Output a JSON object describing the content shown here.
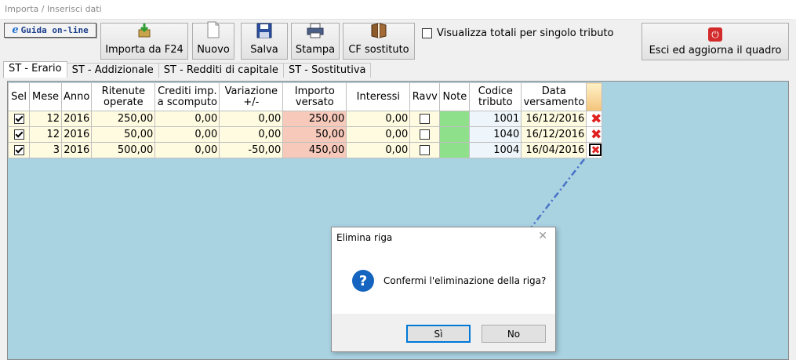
{
  "window": {
    "title": "Importa / Inserisci dati"
  },
  "toolbar": {
    "guida_label": "Guida on-line",
    "guida_icon": "ie-icon",
    "buttons": [
      {
        "label": "Importa da F24",
        "icon": "import-icon"
      },
      {
        "label": "Nuovo",
        "icon": "new-document-icon"
      },
      {
        "label": "Salva",
        "icon": "save-icon"
      },
      {
        "label": "Stampa",
        "icon": "printer-icon"
      },
      {
        "label": "CF sostituto",
        "icon": "book-icon"
      }
    ],
    "checkbox_totali_label": "Visualizza totali per singolo tributo",
    "checkbox_totali_checked": false,
    "exit_label": "Esci ed aggiorna il quadro",
    "exit_icon": "power-icon"
  },
  "tabs": [
    {
      "label": "ST - Erario",
      "active": true
    },
    {
      "label": "ST - Addizionale",
      "active": false
    },
    {
      "label": "ST - Redditi di capitale",
      "active": false
    },
    {
      "label": "ST - Sostitutiva",
      "active": false
    }
  ],
  "table": {
    "columns": {
      "sel": "Sel",
      "mese": "Mese",
      "anno": "Anno",
      "ritenute_1": "Ritenute",
      "ritenute_2": "operate",
      "crediti_1": "Crediti imp.",
      "crediti_2": "a scomputo",
      "variazione_1": "Variazione",
      "variazione_2": "+/-",
      "importo_1": "Importo",
      "importo_2": "versato",
      "interessi": "Interessi",
      "ravv": "Ravv",
      "note": "Note",
      "codice_1": "Codice",
      "codice_2": "tributo",
      "data_1": "Data",
      "data_2": "versamento"
    },
    "rows": [
      {
        "sel": true,
        "mese": "12",
        "anno": "2016",
        "ritenute": "250,00",
        "crediti": "0,00",
        "variazione": "0,00",
        "importo": "250,00",
        "interessi": "0,00",
        "ravv": false,
        "note": "",
        "codice": "1001",
        "data": "16/12/2016"
      },
      {
        "sel": true,
        "mese": "12",
        "anno": "2016",
        "ritenute": "50,00",
        "crediti": "0,00",
        "variazione": "0,00",
        "importo": "50,00",
        "interessi": "0,00",
        "ravv": false,
        "note": "",
        "codice": "1040",
        "data": "16/12/2016"
      },
      {
        "sel": true,
        "mese": "3",
        "anno": "2016",
        "ritenute": "500,00",
        "crediti": "0,00",
        "variazione": "-50,00",
        "importo": "450,00",
        "interessi": "0,00",
        "ravv": false,
        "note": "",
        "codice": "1004",
        "data": "16/04/2016"
      }
    ],
    "delete_icon": "delete-x-icon"
  },
  "dialog": {
    "title": "Elimina riga",
    "message": "Confermi l'eliminazione della riga?",
    "icon": "question-icon",
    "yes_label": "Sì",
    "no_label": "No"
  },
  "colors": {
    "panel_bg": "#aad3e2",
    "row_bg": "#fffbe0",
    "importo_bg": "#f6c9bb",
    "note_bg": "#8fe08a",
    "delete_red": "#e02020",
    "arrow_blue": "#4a72c8"
  }
}
